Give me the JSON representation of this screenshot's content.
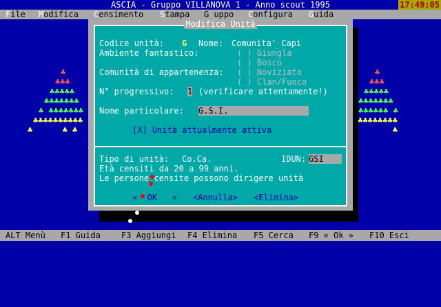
{
  "app": {
    "title": "ASCIA - Gruppo VILLANOVA 1 - Anno scout 1995",
    "clock": "17:49:05"
  },
  "menu": [
    {
      "hot": "F",
      "rest": "ile"
    },
    {
      "hot": "M",
      "rest": "odifica"
    },
    {
      "hot": "C",
      "rest": "ensimento"
    },
    {
      "hot": "S",
      "rest": "tampa"
    },
    {
      "hot": "G",
      "rest": " uppo",
      "pre": "G"
    },
    {
      "hot": "C",
      "rest": "onfigura"
    },
    {
      "hot": "G",
      "rest": "uida"
    }
  ],
  "dialog": {
    "title": "Modifica Unità",
    "codice_label": "Codice unità:",
    "codice_value": "G",
    "nome_label": "Nome:",
    "nome_value": "Comunita' Capi",
    "ambiente_label": "Ambiente fantastico:",
    "ambiente_options": [
      "( ) Giungla",
      "( ) Bosco"
    ],
    "comunita_label": "Comunità di appartenenza:",
    "comunita_options": [
      "( ) Noviziato",
      "( ) Clan/Fuoco"
    ],
    "progressivo_label": "N° progressivo:",
    "progressivo_value": "1",
    "progressivo_note": "(verificare attentamente!)",
    "nome_particolare_label": "Nome particolare:",
    "nome_particolare_value": "G.S.I.",
    "attiva_checkbox": "[X] Unità attualmente attiva",
    "tipo_label": "Tipo di unità:",
    "tipo_value": "Co.Ca.",
    "idun_label": "IDUN:",
    "idun_value": "GSI",
    "eta_text": "Età censiti da 20 a 99 anni.",
    "dirigere_text": "Le persone censite possono dirigere unità",
    "ok_button": "«  OK   »",
    "annulla_button": "<Annulla>",
    "elimina_button": "<Elimina>"
  },
  "statusbar": [
    "ALT Menù",
    "F1 Guida",
    "F3 Aggiungi",
    "F4 Elimina",
    "F5 Cerca",
    "F9 « Ok »",
    "F10 Esci"
  ],
  "colors": {
    "desktop": "#0000a8",
    "menubar": "#a8a8a8",
    "dialog": "#00a8a8",
    "highlight": "#ffff55",
    "clock_bg": "#a8a800",
    "clock_fg": "#a80000"
  }
}
